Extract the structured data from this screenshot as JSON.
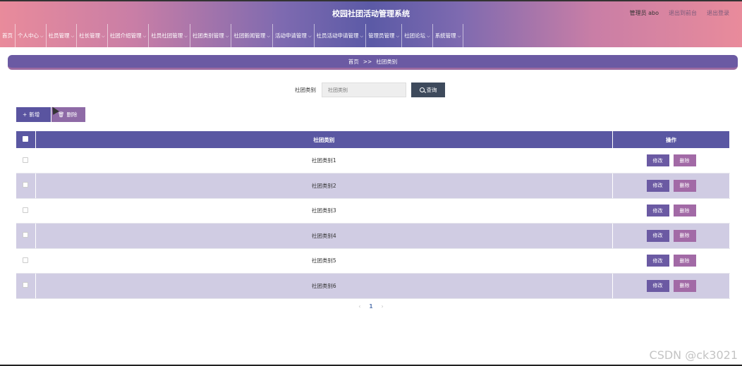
{
  "header": {
    "title": "校园社团活动管理系统",
    "user_label": "管理员 abo",
    "goto_front": "退出到前台",
    "logout": "退出登录"
  },
  "nav": {
    "items": [
      {
        "label": "首页",
        "has_menu": false
      },
      {
        "label": "个人中心",
        "has_menu": true
      },
      {
        "label": "社员管理",
        "has_menu": true
      },
      {
        "label": "社长管理",
        "has_menu": true
      },
      {
        "label": "社团介绍管理",
        "has_menu": true
      },
      {
        "label": "社员社团管理",
        "has_menu": true
      },
      {
        "label": "社团类别管理",
        "has_menu": true
      },
      {
        "label": "社团新闻管理",
        "has_menu": true
      },
      {
        "label": "活动申请管理",
        "has_menu": true
      },
      {
        "label": "社员活动申请管理",
        "has_menu": true
      },
      {
        "label": "管理员管理",
        "has_menu": true
      },
      {
        "label": "社团论坛",
        "has_menu": true
      },
      {
        "label": "系统管理",
        "has_menu": true
      }
    ]
  },
  "breadcrumb": {
    "home": "首页",
    "sep": ">>",
    "current": "社团类别"
  },
  "search": {
    "label": "社团类别",
    "placeholder": "社团类别",
    "button": "查询"
  },
  "actions": {
    "add": "新增",
    "delete": "删除"
  },
  "table": {
    "columns": [
      "社团类别",
      "操作"
    ],
    "rows": [
      {
        "name": "社团类别1"
      },
      {
        "name": "社团类别2"
      },
      {
        "name": "社团类别3"
      },
      {
        "name": "社团类别4"
      },
      {
        "name": "社团类别5"
      },
      {
        "name": "社团类别6"
      }
    ],
    "edit_label": "修改",
    "delete_label": "删除"
  },
  "pager": {
    "prev": "‹",
    "current": "1",
    "next": "›"
  },
  "watermark": "CSDN @ck3021",
  "colors": {
    "primary": "#5a57a2",
    "accent": "#a26aa6",
    "row_alt": "#d0cce3"
  }
}
